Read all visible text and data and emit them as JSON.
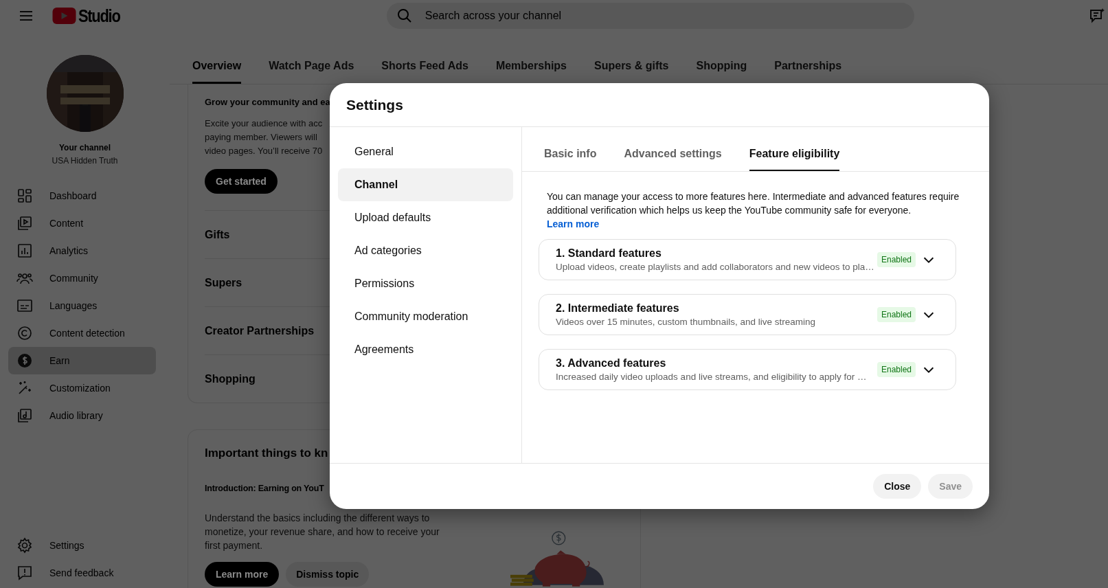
{
  "topbar": {
    "logo": "Studio",
    "search": {
      "placeholder": "Search across your channel"
    }
  },
  "channel": {
    "label": "Your channel",
    "name": "USA Hidden Truth"
  },
  "nav": [
    {
      "label": "Dashboard",
      "selected": false
    },
    {
      "label": "Content",
      "selected": false
    },
    {
      "label": "Analytics",
      "selected": false
    },
    {
      "label": "Community",
      "selected": false
    },
    {
      "label": "Languages",
      "selected": false
    },
    {
      "label": "Content detection",
      "selected": false
    },
    {
      "label": "Earn",
      "selected": true
    },
    {
      "label": "Customization",
      "selected": false
    },
    {
      "label": "Audio library",
      "selected": false
    }
  ],
  "nav_bottom": [
    {
      "label": "Settings"
    },
    {
      "label": "Send feedback"
    }
  ],
  "page_tabs": [
    {
      "label": "Overview",
      "selected": true
    },
    {
      "label": "Watch Page Ads",
      "selected": false
    },
    {
      "label": "Shorts Feed Ads",
      "selected": false
    },
    {
      "label": "Memberships",
      "selected": false
    },
    {
      "label": "Supers & gifts",
      "selected": false
    },
    {
      "label": "Shopping",
      "selected": false
    },
    {
      "label": "Partnerships",
      "selected": false
    }
  ],
  "membership_card": {
    "title": "Grow your community and ea",
    "lines": [
      "Excite your audience with acc",
      "paying member. Viewers will",
      "video pages. You’ll receive 70"
    ],
    "button": "Get started"
  },
  "sections": [
    "Gifts",
    "Supers",
    "Creator Partnerships",
    "Shopping"
  ],
  "important_card": {
    "title": "Important things to kn",
    "subtitle": "Introduction: Earning on YouT",
    "body": "Understand the basics including the different ways to monetize, your revenue share, and how to receive your first payment.",
    "buttons": [
      {
        "label": "Learn more",
        "primary": true
      },
      {
        "label": "Dismiss topic",
        "primary": false
      }
    ]
  },
  "dialog": {
    "title": "Settings",
    "menu": [
      {
        "label": "General",
        "selected": false
      },
      {
        "label": "Channel",
        "selected": true
      },
      {
        "label": "Upload defaults",
        "selected": false
      },
      {
        "label": "Ad categories",
        "selected": false
      },
      {
        "label": "Permissions",
        "selected": false
      },
      {
        "label": "Community moderation",
        "selected": false
      },
      {
        "label": "Agreements",
        "selected": false
      }
    ],
    "tabs": [
      {
        "label": "Basic info",
        "selected": false
      },
      {
        "label": "Advanced settings",
        "selected": false
      },
      {
        "label": "Feature eligibility",
        "selected": true
      }
    ],
    "intro": "You can manage your access to more features here. Intermediate and advanced features require additional verification which helps us keep the YouTube community safe for everyone.",
    "link": "Learn more",
    "features": [
      {
        "title": "1. Standard features",
        "description": "Upload videos, create playlists and add collaborators and new videos to pla…",
        "status": "Enabled",
        "expanded": false
      },
      {
        "title": "2. Intermediate features",
        "description": "Videos over 15 minutes, custom thumbnails, and live streaming",
        "status": "Enabled",
        "expanded": false
      },
      {
        "title": "3. Advanced features",
        "description": "Increased daily video uploads and live streams, and eligibility to apply for …",
        "status": "Enabled",
        "expanded": false
      }
    ],
    "buttons": [
      {
        "label": "Close",
        "disabled": false
      },
      {
        "label": "Save",
        "disabled": true
      }
    ]
  }
}
